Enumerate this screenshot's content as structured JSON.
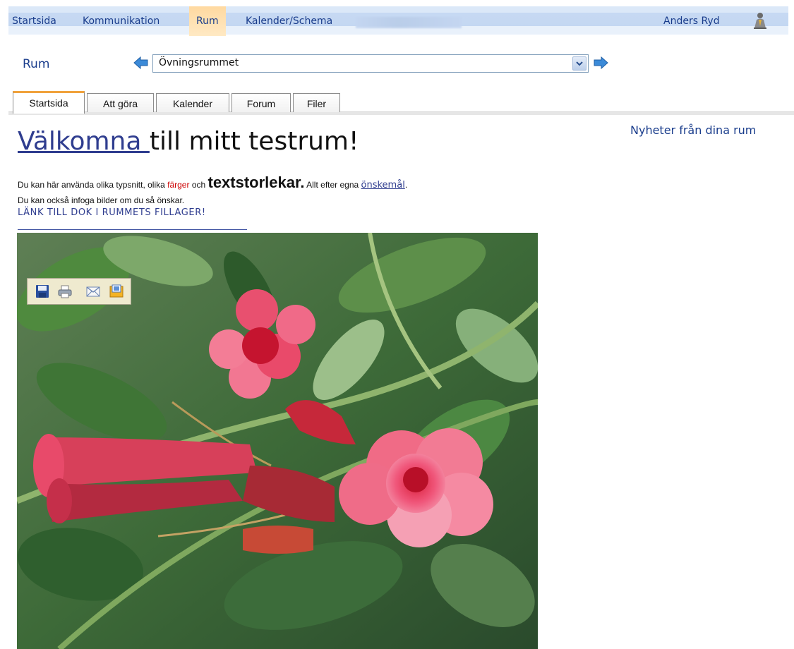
{
  "topnav": {
    "items": [
      {
        "label": "Startsida"
      },
      {
        "label": "Kommunikation"
      },
      {
        "label": "Rum",
        "active": true
      },
      {
        "label": "Kalender/Schema"
      }
    ],
    "user": {
      "name": "Anders Ryd",
      "icon": "user-icon"
    }
  },
  "room": {
    "label": "Rum",
    "selected": "Övningsrummet",
    "prev_icon": "arrow-left-icon",
    "next_icon": "arrow-right-icon"
  },
  "tabs": [
    {
      "label": "Startsida",
      "active": true
    },
    {
      "label": "Att göra"
    },
    {
      "label": "Kalender"
    },
    {
      "label": "Forum"
    },
    {
      "label": "Filer"
    }
  ],
  "content": {
    "welcome_link": "Välkomna ",
    "welcome_rest": "till mitt testrum!",
    "news_link": "Nyheter från dina rum",
    "line1": {
      "a": "Du kan här använda olika typsnitt, olika ",
      "red": "färger",
      "b": " och ",
      "big": "textstorlekar.",
      "c": " Allt efter egna ",
      "link": "önskemål",
      "d": "."
    },
    "line2": "Du kan också infoga bilder om du så önskar.",
    "line3": "LÄNK TILL DOK I RUMMETS FILLAGER!",
    "image_toolbar": [
      "save-icon",
      "print-icon",
      "email-icon",
      "my-pictures-icon"
    ]
  },
  "colors": {
    "nav_text": "#1a3d8c",
    "nav_active": "#ffd9a0",
    "link": "#2f3d8f",
    "highlight_red": "#cc0000",
    "tab_accent": "#f0a23c"
  }
}
